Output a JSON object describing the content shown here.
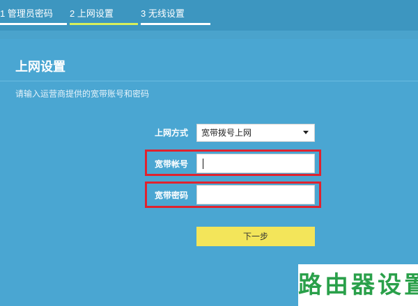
{
  "steps": [
    {
      "label": "1 管理员密码",
      "active": false
    },
    {
      "label": "2 上网设置",
      "active": true
    },
    {
      "label": "3 无线设置",
      "active": false
    }
  ],
  "page": {
    "title": "上网设置",
    "hint": "请输入运营商提供的宽带账号和密码"
  },
  "form": {
    "connection_type": {
      "label": "上网方式",
      "value": "宽带拨号上网"
    },
    "account": {
      "label": "宽带帐号",
      "value": ""
    },
    "password": {
      "label": "宽带密码",
      "value": ""
    },
    "next_label": "下一步"
  },
  "watermark": "路由器设置",
  "colors": {
    "background": "#4aa6d2",
    "active_step": "#d8f05a",
    "highlight": "#e0222e",
    "next_button": "#f3e55a",
    "watermark": "#2aa04a"
  },
  "icons": {
    "select_arrow": "caret-down-icon"
  }
}
